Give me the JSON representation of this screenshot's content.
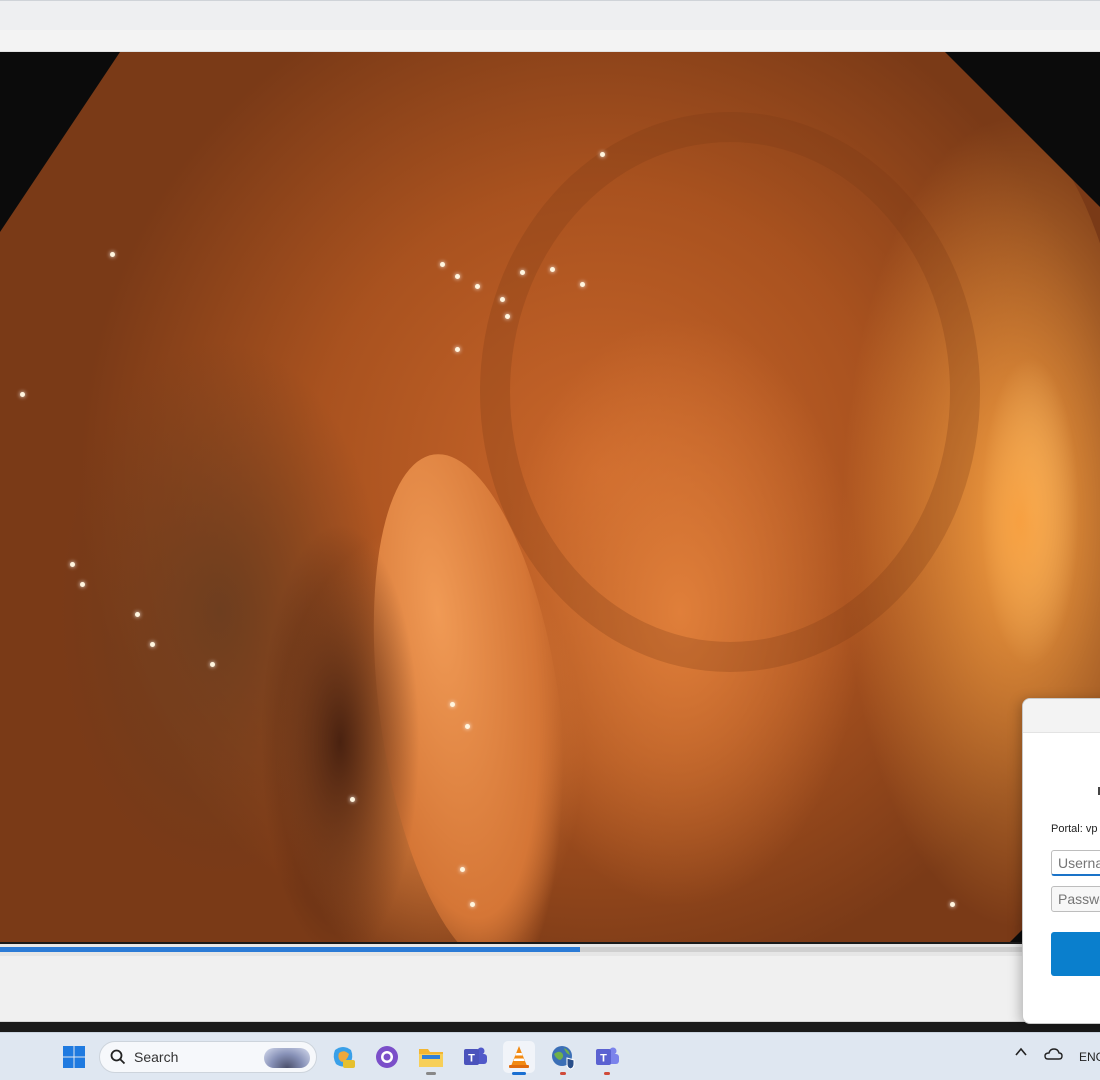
{
  "dialog": {
    "portal_text": "Portal: vp",
    "username_placeholder": "Userna",
    "password_placeholder": "Passwo"
  },
  "video": {
    "progress_fraction": 0.527
  },
  "taskbar": {
    "search_placeholder": "Search",
    "language": "ENG",
    "apps": [
      {
        "name": "start-button"
      },
      {
        "name": "copilot-pre-app"
      },
      {
        "name": "github-desktop-app"
      },
      {
        "name": "file-explorer-app"
      },
      {
        "name": "teams-work-app"
      },
      {
        "name": "vlc-app"
      },
      {
        "name": "vpn-globe-app"
      },
      {
        "name": "teams-app"
      }
    ]
  },
  "colors": {
    "accent": "#0a7fcd",
    "seek_fill": "#2b7bd6"
  }
}
